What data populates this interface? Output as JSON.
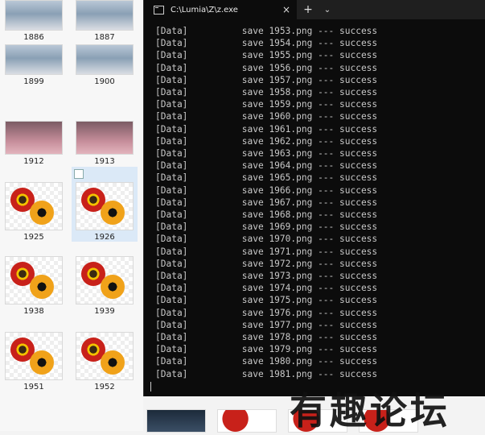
{
  "terminal": {
    "tab_title": "C:\\Lumia\\Z\\z.exe",
    "new_tab": "+",
    "close": "×",
    "dropdown": "⌄",
    "lines": [
      "[Data]          save 1953.png --- success",
      "[Data]          save 1954.png --- success",
      "[Data]          save 1955.png --- success",
      "[Data]          save 1956.png --- success",
      "[Data]          save 1957.png --- success",
      "[Data]          save 1958.png --- success",
      "[Data]          save 1959.png --- success",
      "[Data]          save 1960.png --- success",
      "[Data]          save 1961.png --- success",
      "[Data]          save 1962.png --- success",
      "[Data]          save 1963.png --- success",
      "[Data]          save 1964.png --- success",
      "[Data]          save 1965.png --- success",
      "[Data]          save 1966.png --- success",
      "[Data]          save 1967.png --- success",
      "[Data]          save 1968.png --- success",
      "[Data]          save 1969.png --- success",
      "[Data]          save 1970.png --- success",
      "[Data]          save 1971.png --- success",
      "[Data]          save 1972.png --- success",
      "[Data]          save 1973.png --- success",
      "[Data]          save 1974.png --- success",
      "[Data]          save 1975.png --- success",
      "[Data]          save 1976.png --- success",
      "[Data]          save 1977.png --- success",
      "[Data]          save 1978.png --- success",
      "[Data]          save 1979.png --- success",
      "[Data]          save 1980.png --- success",
      "[Data]          save 1981.png --- success"
    ]
  },
  "files": [
    {
      "name": "1886",
      "kind": "anime"
    },
    {
      "name": "1887",
      "kind": "anime"
    },
    {
      "name": "1899",
      "kind": "anime"
    },
    {
      "name": "1900",
      "kind": "anime"
    },
    {
      "name": "1912",
      "kind": "pink"
    },
    {
      "name": "1913",
      "kind": "pink"
    },
    {
      "name": "1925",
      "kind": "flower"
    },
    {
      "name": "1926",
      "kind": "flower",
      "selected": true
    },
    {
      "name": "1938",
      "kind": "flower"
    },
    {
      "name": "1939",
      "kind": "flower"
    },
    {
      "name": "1951",
      "kind": "flower"
    },
    {
      "name": "1952",
      "kind": "flower"
    }
  ],
  "watermark": "有趣论坛"
}
